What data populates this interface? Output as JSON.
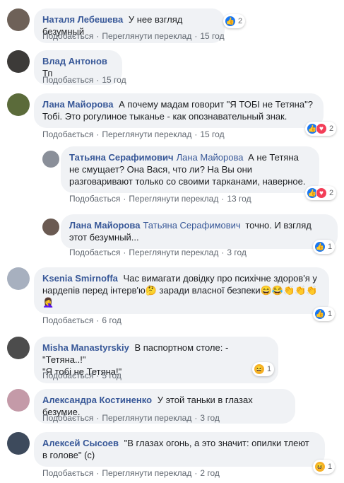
{
  "labels": {
    "like": "Подобається",
    "translate": "Переглянути переклад"
  },
  "comments": [
    {
      "author": "Наталя Лебешева",
      "text": "У нее взгляд безумный",
      "time": "15 год",
      "reactions": "2"
    },
    {
      "author": "Влад Антонов",
      "text": "Тп",
      "time": "15 год"
    },
    {
      "author": "Лана Майорова",
      "text": "А почему мадам говорит \"Я ТОБІ не Тетяна\"? Тобі. Это рогулиное тыканье - как опознавательный знак.",
      "time": "15 год",
      "reactions": "2"
    },
    {
      "author": "Татьяна Серафимович",
      "mention": "Лана Майорова",
      "text": "А не Тетяна не смущает? Она Вася, что ли? На Вы они разговаривают только со своими тарканами, наверное.",
      "time": "13 год",
      "reactions": "2"
    },
    {
      "author": "Лана Майорова",
      "mention": "Татьяна Серафимович",
      "text": "точно. И взгляд этот безумный...",
      "time": "3 год",
      "reactions": "1"
    },
    {
      "author": "Ksenia Smirnoffa",
      "text": "Час вимагати довідку про психічне здоров'я у нардепів перед інтерв'ю",
      "text2": "заради власної безпеки",
      "time": "6 год",
      "reactions": "1"
    },
    {
      "author": "Misha Manastyrskiy",
      "text": "В паспортном столе: -\"Тетяна..!\"",
      "text2": "\"Я тобі не Тетяна!\"",
      "time": "5 год",
      "reactions": "1"
    },
    {
      "author": "Александра Костиненко",
      "text": "У этой таньки в глазах безумие.",
      "time": "3 год"
    },
    {
      "author": "Алексей Сысоев",
      "text": "\"В глазах огонь, а это значит: опилки тлеют в голове\" (с)",
      "time": "2 год",
      "reactions": "1"
    }
  ]
}
